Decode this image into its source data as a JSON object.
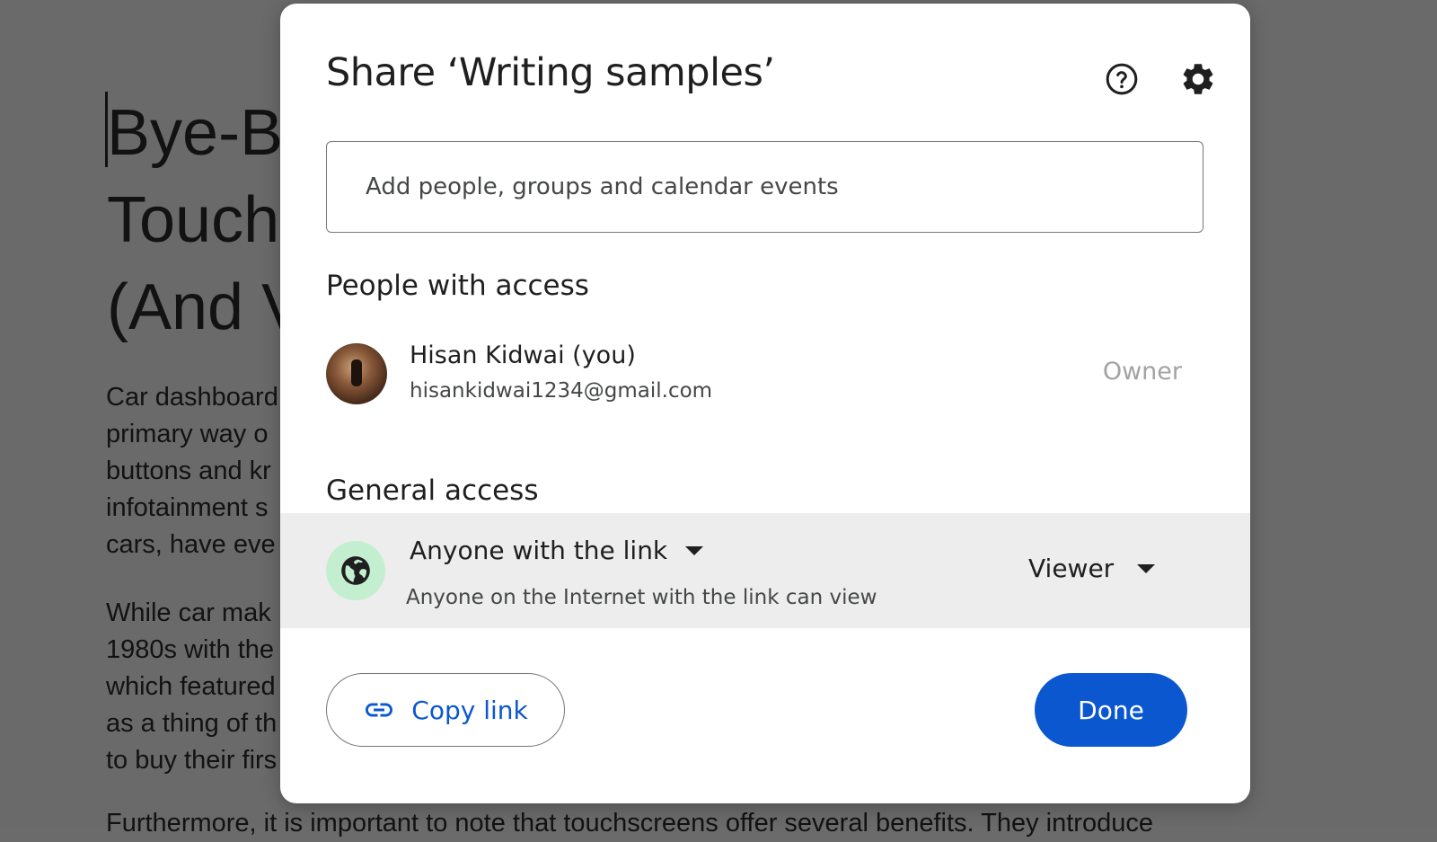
{
  "document": {
    "title": "Bye-B\nTouch\n(And V",
    "paragraph1": "Car dashboard\nprimary way o\nbuttons and kr\ninfotainment s\ncars, have eve",
    "paragraph2": "While car mak\n1980s with the\nwhich featured\nas a thing of th\nto buy their firs",
    "paragraph3": "Furthermore, it is important to note that touchscreens offer several benefits. They introduce"
  },
  "dialog": {
    "title": "Share ‘Writing samples’",
    "help_icon": "help-circle-icon",
    "settings_icon": "gear-icon",
    "add_input": {
      "placeholder": "Add people, groups and calendar events",
      "value": ""
    },
    "people_section_title": "People with access",
    "people": [
      {
        "name": "Hisan Kidwai (you)",
        "email": "hisankidwai1234@gmail.com",
        "role": "Owner"
      }
    ],
    "general_section_title": "General access",
    "general_access": {
      "scope_label": "Anyone with the link",
      "description": "Anyone on the Internet with the link can view",
      "role": "Viewer",
      "icon": "globe-icon"
    },
    "copy_link_label": "Copy link",
    "done_label": "Done"
  },
  "colors": {
    "primary": "#0b57d0",
    "globe_bg": "#c4eed0",
    "access_row_bg": "#ededed",
    "overlay": "#6a6a6a"
  }
}
